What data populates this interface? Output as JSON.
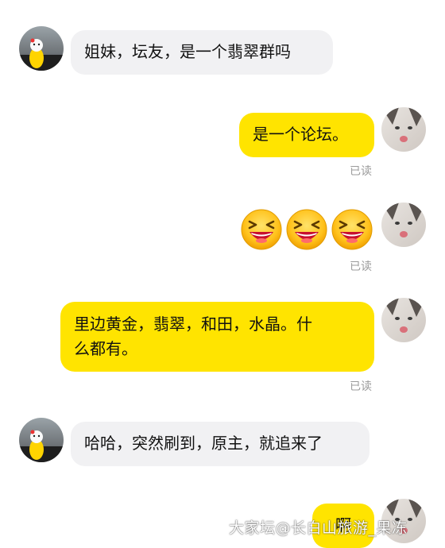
{
  "messages": [
    {
      "side": "left",
      "text": "姐妹，坛友，是一个翡翠群吗"
    },
    {
      "side": "right",
      "text": "是一个论坛。",
      "status": "已读"
    },
    {
      "side": "right",
      "emoji": [
        "laughing-emoji",
        "laughing-emoji",
        "laughing-emoji"
      ],
      "status": "已读"
    },
    {
      "side": "right",
      "text": "里边黄金，翡翠，和田，水晶。什么都有。",
      "line1": "里边黄金，翡翠，和田，水晶。什",
      "line2": "么都有。",
      "status": "已读"
    },
    {
      "side": "left",
      "text": "哈哈，突然刷到，原主，就追来了"
    },
    {
      "side": "right",
      "text": "啊"
    }
  ],
  "watermark": "大家坛@长白山旅游_果冻",
  "colors": {
    "own_bubble": "#ffe400",
    "other_bubble": "#f1f1f3",
    "read_status": "#9b9b9b"
  }
}
